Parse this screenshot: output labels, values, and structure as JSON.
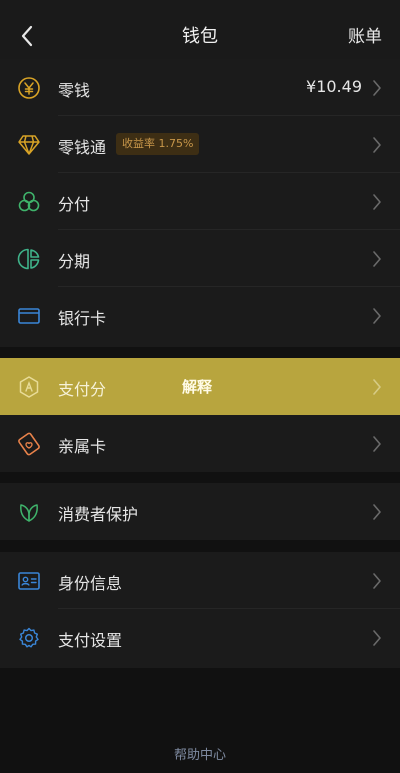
{
  "nav": {
    "back_icon": "chevron-left-icon",
    "title": "钱包",
    "right_label": "账单"
  },
  "group1": [
    {
      "id": "lingqian",
      "icon": "yuan-coin-icon",
      "label": "零钱",
      "value": "¥10.49",
      "color": "#d8a326"
    },
    {
      "id": "lingqiantong",
      "icon": "diamond-icon",
      "label": "零钱通",
      "badge": "收益率 1.75%",
      "color": "#d8a326"
    },
    {
      "id": "fenfu",
      "icon": "clover-icon",
      "label": "分付",
      "color": "#3fb36b"
    },
    {
      "id": "fenqi",
      "icon": "installment-icon",
      "label": "分期",
      "color": "#3fb38a"
    },
    {
      "id": "yinhangka",
      "icon": "bank-card-icon",
      "label": "银行卡",
      "color": "#3a86d8"
    }
  ],
  "group2": [
    {
      "id": "zhifufen",
      "icon": "score-icon",
      "label": "支付分",
      "overlay": "解释",
      "highlighted": true
    },
    {
      "id": "qinshuka",
      "icon": "family-card-icon",
      "label": "亲属卡",
      "color": "#e8824a"
    }
  ],
  "group3": [
    {
      "id": "xiaofeizhe",
      "icon": "leaf-shield-icon",
      "label": "消费者保护",
      "color": "#3fb36b"
    }
  ],
  "group4": [
    {
      "id": "shenfen",
      "icon": "id-card-icon",
      "label": "身份信息",
      "color": "#3a86d8"
    },
    {
      "id": "shezhi",
      "icon": "gear-icon",
      "label": "支付设置",
      "color": "#3a86d8"
    }
  ],
  "footer": {
    "help_label": "帮助中心"
  },
  "colors": {
    "background": "#111111",
    "card": "#1b1b1b",
    "highlight": "#b8a53e"
  }
}
